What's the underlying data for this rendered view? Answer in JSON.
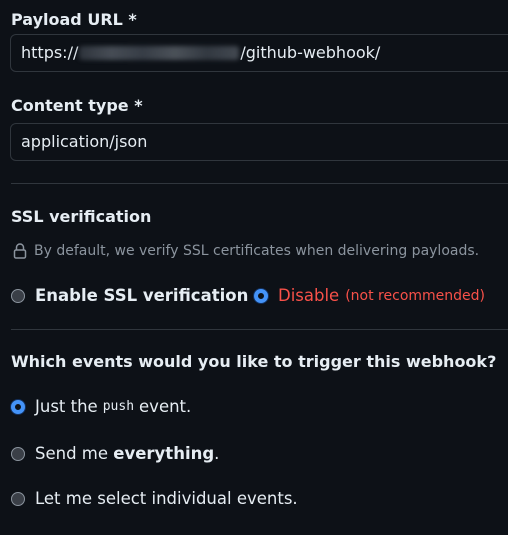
{
  "payload_url": {
    "label": "Payload URL *",
    "value_prefix": "https://",
    "value_suffix": "/github-webhook/"
  },
  "content_type": {
    "label": "Content type *",
    "value": "application/json"
  },
  "ssl": {
    "heading": "SSL verification",
    "note": "By default, we verify SSL certificates when delivering payloads.",
    "option_enable": "Enable SSL verification",
    "option_disable": "Disable",
    "option_disable_note": "(not recommended)",
    "selected": "disable"
  },
  "events": {
    "heading": "Which events would you like to trigger this webhook?",
    "option_push_prefix": "Just the",
    "option_push_code": "push",
    "option_push_suffix": "event.",
    "option_everything_prefix": "Send me",
    "option_everything_bold": "everything",
    "option_everything_suffix": ".",
    "option_individual": "Let me select individual events.",
    "selected": "push"
  },
  "icons": {
    "ssl_note_icon": "lock-icon"
  },
  "colors": {
    "background": "#0d1117",
    "border": "#30363d",
    "accent": "#4493f8",
    "danger": "#f85149",
    "muted": "#8b949e"
  }
}
